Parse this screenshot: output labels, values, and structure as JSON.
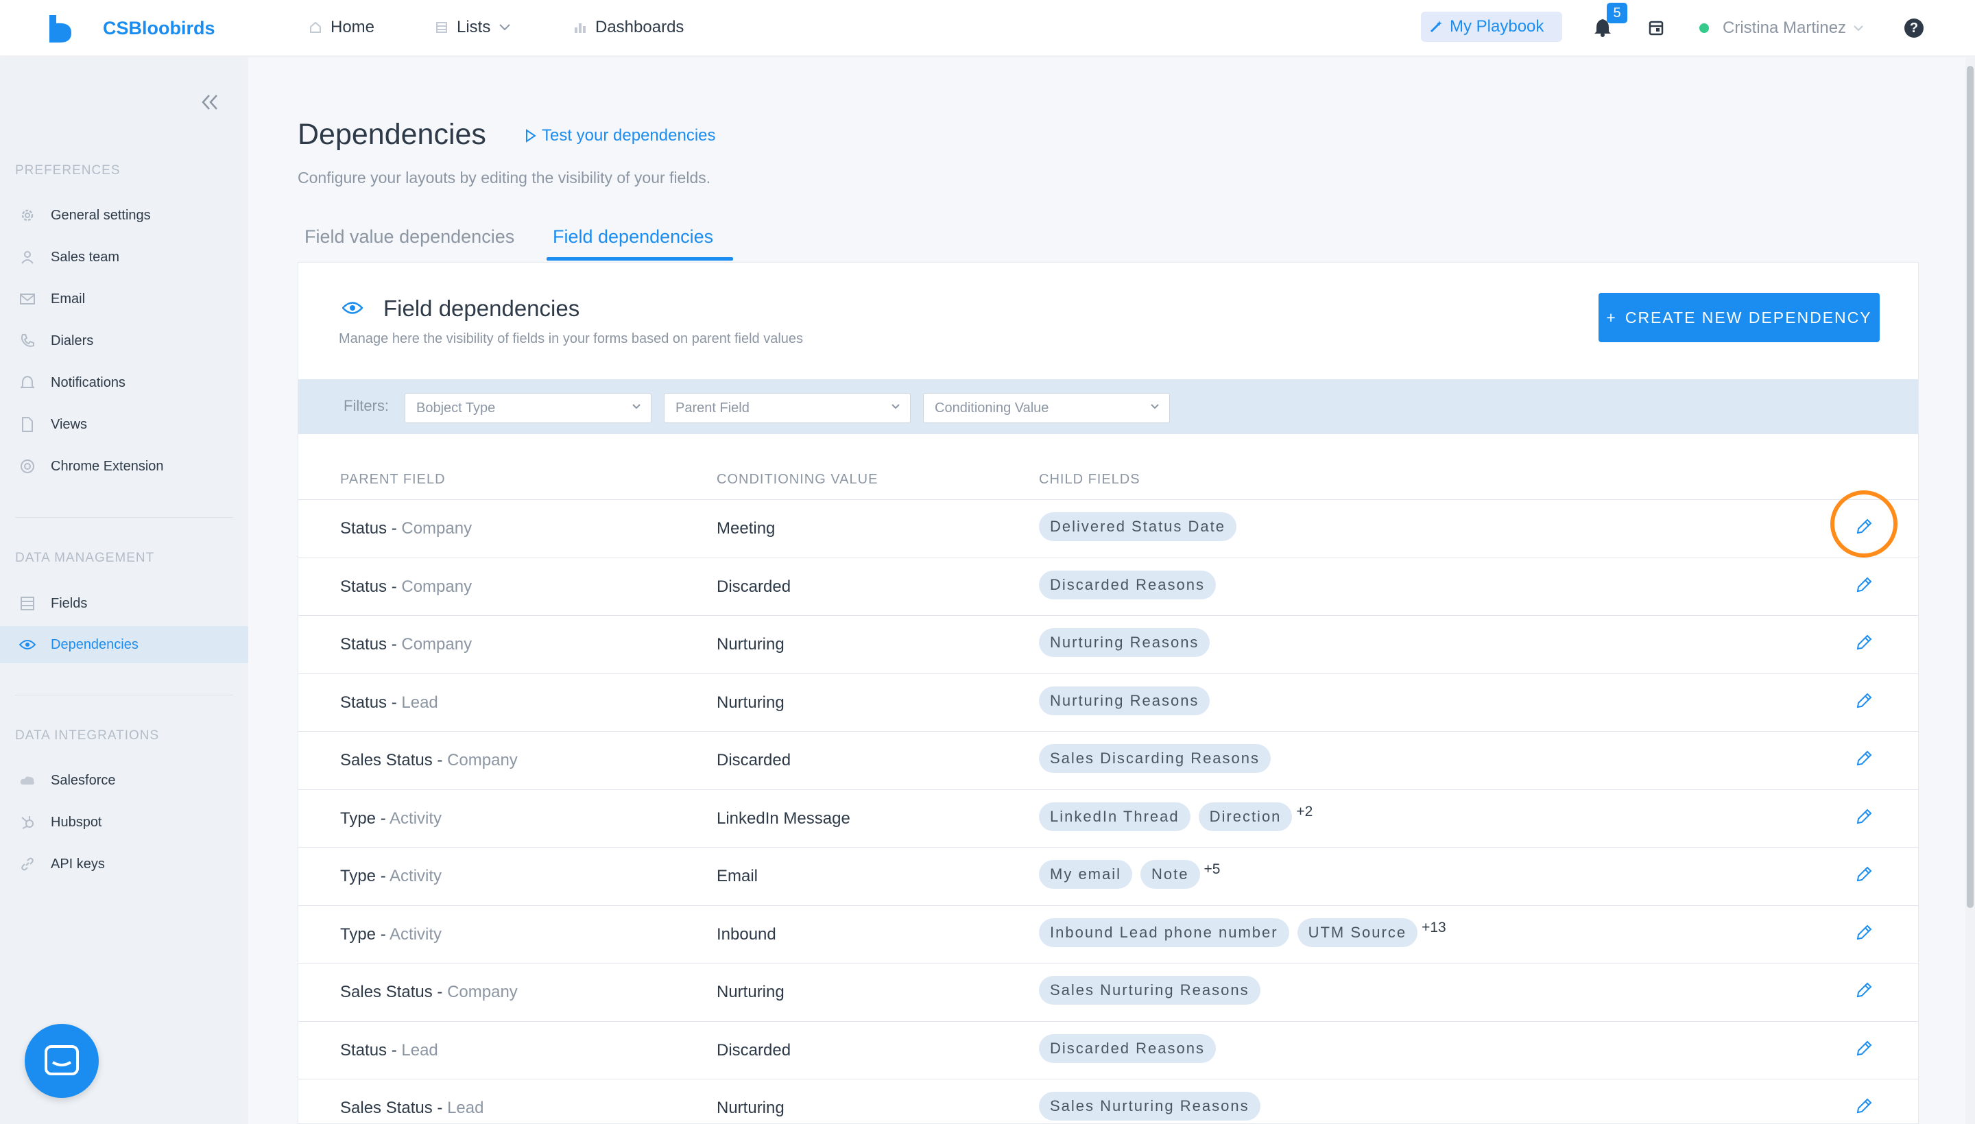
{
  "app": {
    "brand": "CSBloobirds"
  },
  "nav": {
    "home": "Home",
    "lists": "Lists",
    "dashboards": "Dashboards"
  },
  "topbar": {
    "playbook": "My Playbook",
    "notifications_count": "5",
    "user_name": "Cristina Martinez",
    "help": "?"
  },
  "sidebar": {
    "preferences_title": "PREFERENCES",
    "preferences": [
      {
        "label": "General settings",
        "icon": "gear-icon"
      },
      {
        "label": "Sales team",
        "icon": "user-icon"
      },
      {
        "label": "Email",
        "icon": "mail-icon"
      },
      {
        "label": "Dialers",
        "icon": "phone-icon"
      },
      {
        "label": "Notifications",
        "icon": "bell-icon"
      },
      {
        "label": "Views",
        "icon": "file-icon"
      },
      {
        "label": "Chrome Extension",
        "icon": "chrome-icon"
      }
    ],
    "data_management_title": "DATA MANAGEMENT",
    "data_management": [
      {
        "label": "Fields",
        "icon": "list-icon"
      },
      {
        "label": "Dependencies",
        "icon": "eye-icon",
        "active": true
      }
    ],
    "data_integrations_title": "DATA INTEGRATIONS",
    "data_integrations": [
      {
        "label": "Salesforce",
        "icon": "cloud-icon"
      },
      {
        "label": "Hubspot",
        "icon": "hubspot-icon"
      },
      {
        "label": "API keys",
        "icon": "link-icon"
      }
    ]
  },
  "page": {
    "title": "Dependencies",
    "test_link": "Test your dependencies",
    "subtitle": "Configure your layouts by editing the visibility of your fields.",
    "tabs": [
      {
        "label": "Field value dependencies",
        "active": false
      },
      {
        "label": "Field dependencies",
        "active": true
      }
    ]
  },
  "card": {
    "title": "Field dependencies",
    "subtitle": "Manage here the visibility of fields in your forms based on parent field values",
    "create_button": "CREATE NEW DEPENDENCY",
    "filters_label": "Filters:",
    "filters": {
      "object_type": "Bobject Type",
      "parent_field": "Parent Field",
      "conditioning_value": "Conditioning Value"
    }
  },
  "table": {
    "headers": {
      "parent": "PARENT FIELD",
      "conditioning": "CONDITIONING VALUE",
      "child": "CHILD FIELDS"
    },
    "rows": [
      {
        "field": "Status",
        "object": "Company",
        "value": "Meeting",
        "children": [
          "Delivered Status Date"
        ],
        "more": ""
      },
      {
        "field": "Status",
        "object": "Company",
        "value": "Discarded",
        "children": [
          "Discarded Reasons"
        ],
        "more": ""
      },
      {
        "field": "Status",
        "object": "Company",
        "value": "Nurturing",
        "children": [
          "Nurturing Reasons"
        ],
        "more": ""
      },
      {
        "field": "Status",
        "object": "Lead",
        "value": "Nurturing",
        "children": [
          "Nurturing Reasons"
        ],
        "more": ""
      },
      {
        "field": "Sales Status",
        "object": "Company",
        "value": "Discarded",
        "children": [
          "Sales Discarding Reasons"
        ],
        "more": ""
      },
      {
        "field": "Type",
        "object": "Activity",
        "value": "LinkedIn Message",
        "children": [
          "LinkedIn Thread",
          "Direction"
        ],
        "more": "+2"
      },
      {
        "field": "Type",
        "object": "Activity",
        "value": "Email",
        "children": [
          "My email",
          "Note"
        ],
        "more": "+5"
      },
      {
        "field": "Type",
        "object": "Activity",
        "value": "Inbound",
        "children": [
          "Inbound Lead phone number",
          "UTM Source"
        ],
        "more": "+13"
      },
      {
        "field": "Sales Status",
        "object": "Company",
        "value": "Nurturing",
        "children": [
          "Sales Nurturing Reasons"
        ],
        "more": ""
      },
      {
        "field": "Status",
        "object": "Lead",
        "value": "Discarded",
        "children": [
          "Discarded Reasons"
        ],
        "more": ""
      },
      {
        "field": "Sales Status",
        "object": "Lead",
        "value": "Nurturing",
        "children": [
          "Sales Nurturing Reasons"
        ],
        "more": ""
      }
    ]
  },
  "colors": {
    "accent": "#1b8df0",
    "highlight": "#ff8c1a",
    "sidebar_bg": "#eef2f6",
    "filter_bg": "#dde8f5"
  }
}
